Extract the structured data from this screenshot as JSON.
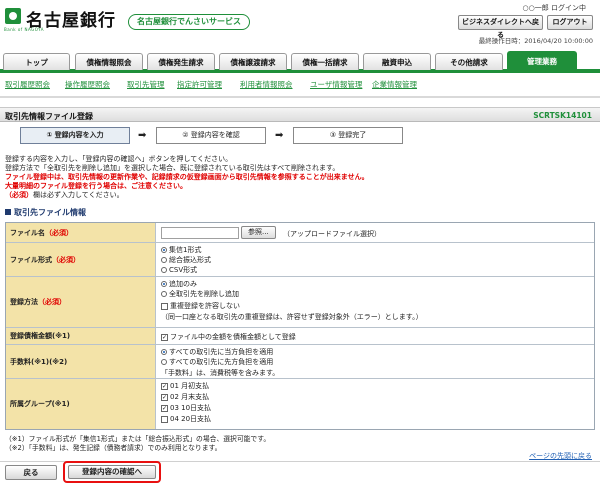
{
  "header": {
    "bank_name": "名古屋銀行",
    "logo_sub": "Bank of NAGOYA",
    "service_name": "名古屋銀行でんさいサービス",
    "login_user": "○○一郎 ログイン中",
    "direct_button": "ビジネスダイレクトへ戻る",
    "logout_button": "ログアウト",
    "last_operation": "最終操作日時：2016/04/20 10:00:00"
  },
  "tabs": [
    {
      "label": "トップ"
    },
    {
      "label": "債権情報照会"
    },
    {
      "label": "債権発生請求"
    },
    {
      "label": "債権譲渡請求"
    },
    {
      "label": "債権一括請求"
    },
    {
      "label": "融資申込"
    },
    {
      "label": "その他請求"
    },
    {
      "label": "管理業務"
    }
  ],
  "subnav": [
    {
      "label": "取引履歴照会"
    },
    {
      "label": "操作履歴照会"
    },
    {
      "label": "取引先管理"
    },
    {
      "label": "指定許可管理"
    },
    {
      "label": "利用者情報照会"
    },
    {
      "label": "ユーザ情報管理"
    },
    {
      "label": "企業情報管理"
    }
  ],
  "page": {
    "title": "取引先情報ファイル登録",
    "code": "SCRTSK14101"
  },
  "steps": [
    {
      "label": "① 登録内容を入力"
    },
    {
      "label": "② 登録内容を確認"
    },
    {
      "label": "③ 登録完了"
    }
  ],
  "step_arrow": "➡",
  "instructions": {
    "line1": "登録する内容を入力し、「登録内容の確認へ」ボタンを押してください。",
    "line2": "登録方法で「全取引先を削除し追加」を選択した場合、既に登録されている取引先はすべて削除されます。",
    "warn1": "ファイル登録中は、取引先情報の更新作業や、記録請求の仮登録画面から取引先情報を参照することが出来ません。",
    "warn2": "大量明細のファイル登録を行う場合は、ご注意ください。",
    "required_mark": "（必須）",
    "required_note": "欄は必ず入力してください。"
  },
  "section_title": "取引先ファイル情報",
  "form": {
    "file_name": {
      "label": "ファイル名",
      "required": "（必須）",
      "browse": "参照...",
      "hint": "（アップロードファイル選択）"
    },
    "file_format": {
      "label": "ファイル形式",
      "required": "（必須）",
      "options": [
        "集信1形式",
        "総合振込形式",
        "CSV形式"
      ],
      "selected": 0
    },
    "registration_method": {
      "label": "登録方法",
      "required": "（必須）",
      "options": [
        "追加のみ",
        "全取引先を削除し追加"
      ],
      "selected": 0,
      "allow_duplicate": "重複登録を許容しない",
      "duplicate_note": "（同一口座となる取引先の重複登録は、許容せず登録対象外（エラー）とします。）",
      "allow_duplicate_checked": false
    },
    "registration_amount": {
      "label": "登録債権金額(※1)",
      "checkbox": "ファイル中の金額を債権金額として登録",
      "checked": true
    },
    "fee": {
      "label": "手数料(※1)(※2)",
      "options": [
        "すべての取引先に当方負担を適用",
        "すべての取引先に先方負担を適用"
      ],
      "selected": 0,
      "note": "「手数料」は、消費税等を含みます。"
    },
    "group": {
      "label": "所属グループ(※1)",
      "items": [
        {
          "label": "01 月初支払",
          "checked": true
        },
        {
          "label": "02 月末支払",
          "checked": true
        },
        {
          "label": "03 10日支払",
          "checked": true
        },
        {
          "label": "04 20日支払",
          "checked": false
        }
      ]
    }
  },
  "notes": {
    "n1": "（※1）ファイル形式が「集信1形式」または「総合振込形式」の場合、選択可能です。",
    "n2": "（※2）「手数料」は、発生記録（債務者請求）でのみ利用となります。"
  },
  "page_top": "ページの先頭に戻る",
  "buttons": {
    "back": "戻る",
    "confirm": "登録内容の確認へ"
  },
  "colors": {
    "brand": "#1f8f3a",
    "required": "#e00000",
    "label_bg": "#f3e3a8",
    "highlight": "#e81010"
  }
}
